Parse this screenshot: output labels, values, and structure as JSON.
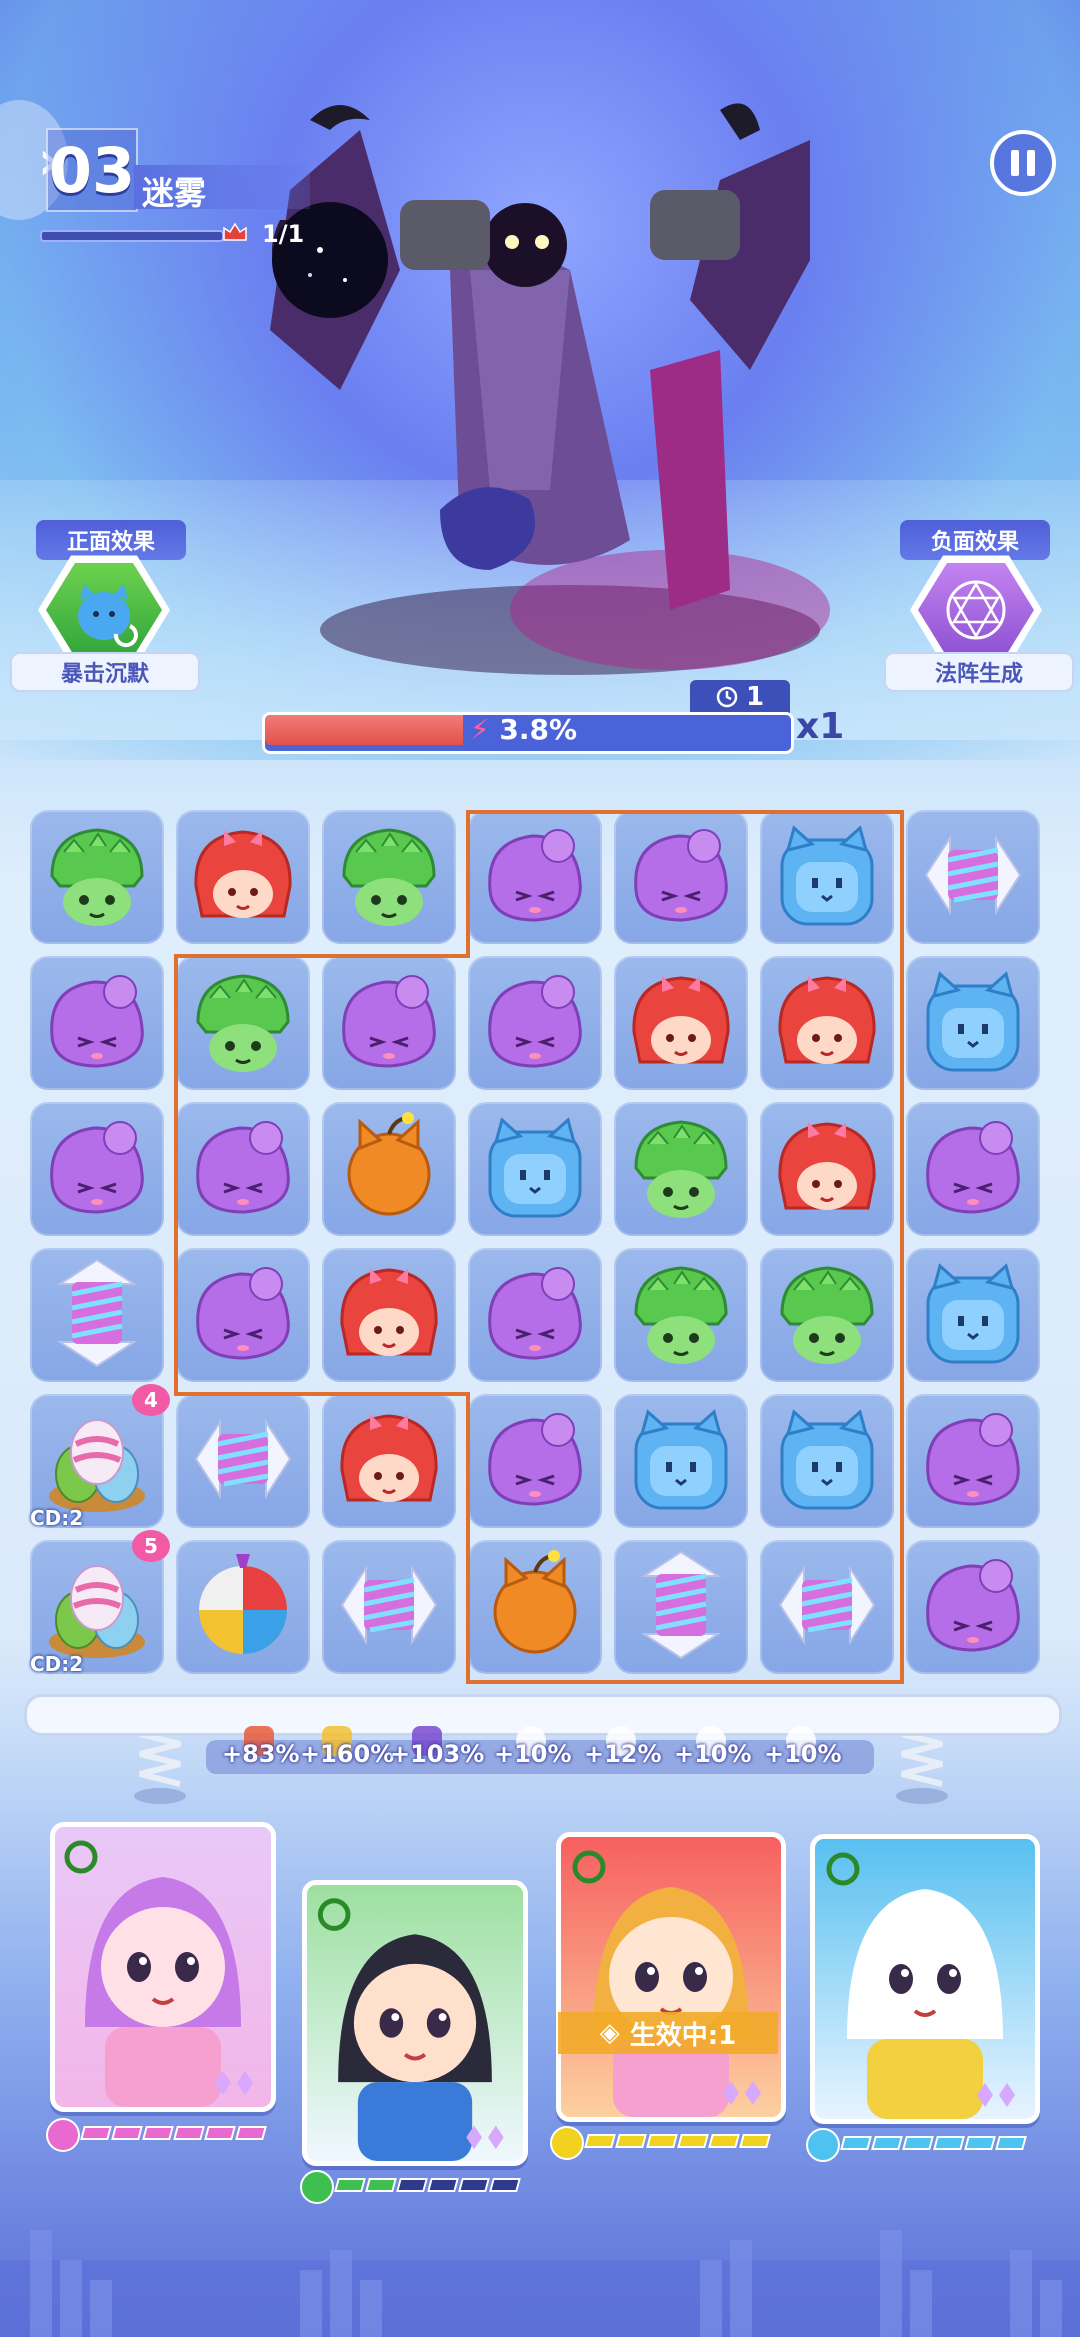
{
  "level": {
    "number": "03",
    "name": "迷雾",
    "enemy_count": "1/1"
  },
  "effects": {
    "positive": {
      "title": "正面效果",
      "label": "暴击沉默"
    },
    "negative": {
      "title": "负面效果",
      "label": "法阵生成"
    }
  },
  "progress": {
    "percent_text": "3.8%",
    "fill_fraction": 0.38,
    "timer": "1",
    "multiplier": "x1"
  },
  "board": {
    "rows": [
      [
        "dragon",
        "redhair",
        "dragon",
        "purple",
        "purple",
        "bluecat",
        "h-arrow"
      ],
      [
        "purple",
        "dragon",
        "purple",
        "purple",
        "redhair",
        "redhair",
        "bluecat"
      ],
      [
        "purple",
        "purple",
        "fox-bomb",
        "bluecat",
        "dragon",
        "redhair",
        "purple"
      ],
      [
        "v-arrow",
        "purple",
        "redhair",
        "purple",
        "dragon",
        "dragon",
        "bluecat"
      ],
      [
        "eggs",
        "h-arrow",
        "redhair",
        "purple",
        "bluecat",
        "bluecat",
        "purple"
      ],
      [
        "eggs",
        "beachball",
        "h-arrow",
        "fox-bomb",
        "v-arrow",
        "h-arrow",
        "purple"
      ]
    ],
    "specials": [
      {
        "row": 4,
        "col": 0,
        "badge": "4",
        "cd": "CD:2"
      },
      {
        "row": 5,
        "col": 0,
        "badge": "5",
        "cd": "CD:2"
      }
    ]
  },
  "boosts": [
    "+83%",
    "+160%",
    "+103%",
    "+10%",
    "+12%",
    "+10%",
    "+10%"
  ],
  "heroes": [
    {
      "name": "pink-girl",
      "energy": 6,
      "segments": 6,
      "color": "#e86ad0"
    },
    {
      "name": "dragon-boy",
      "energy": 2,
      "segments": 6,
      "color": "#3fbf4f"
    },
    {
      "name": "red-girl",
      "energy": 6,
      "segments": 6,
      "color": "#f1d21e",
      "buff": "生效中:1"
    },
    {
      "name": "astro-bear",
      "energy": 6,
      "segments": 6,
      "color": "#4fc3ef"
    }
  ],
  "colors": {
    "accent": "#4a5ad0",
    "outline": "#e07030"
  }
}
